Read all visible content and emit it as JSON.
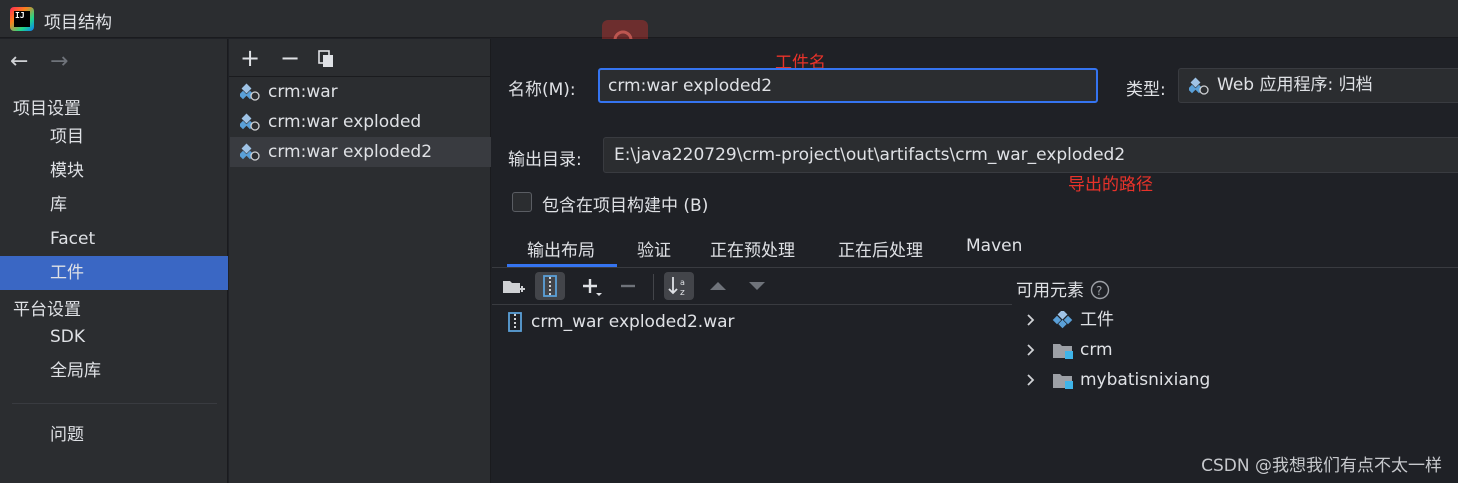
{
  "window": {
    "title": "项目结构"
  },
  "sidebar": {
    "project_settings_label": "项目设置",
    "project_items": [
      {
        "label": "项目"
      },
      {
        "label": "模块"
      },
      {
        "label": "库"
      },
      {
        "label": "Facet"
      },
      {
        "label": "工件",
        "selected": true
      }
    ],
    "platform_settings_label": "平台设置",
    "platform_items": [
      {
        "label": "SDK"
      },
      {
        "label": "全局库"
      }
    ],
    "problems_label": "问题"
  },
  "artifacts": {
    "items": [
      {
        "label": "crm:war"
      },
      {
        "label": "crm:war exploded"
      },
      {
        "label": "crm:war exploded2",
        "selected": true
      }
    ]
  },
  "form": {
    "name_label": "名称(M):",
    "name_value": "crm:war exploded2",
    "type_label": "类型:",
    "type_value": "Web 应用程序: 归档",
    "output_label": "输出目录:",
    "output_value": "E:\\java220729\\crm-project\\out\\artifacts\\crm_war_exploded2",
    "include_build_label": "包含在项目构建中 (B)",
    "include_build_checked": false
  },
  "annotations": {
    "name_note": "工件名",
    "path_note": "导出的路径"
  },
  "tabs": [
    {
      "label": "输出布局",
      "active": true
    },
    {
      "label": "验证"
    },
    {
      "label": "正在预处理"
    },
    {
      "label": "正在后处理"
    },
    {
      "label": "Maven"
    }
  ],
  "layout": {
    "root_item": "crm_war exploded2.war"
  },
  "available": {
    "title": "可用元素",
    "items": [
      {
        "label": "工件",
        "icon": "artifact-icon"
      },
      {
        "label": "crm",
        "icon": "module-folder-icon"
      },
      {
        "label": "mybatisnixiang",
        "icon": "module-folder-icon"
      }
    ]
  },
  "watermark": "CSDN @我想我们有点不太一样",
  "colors": {
    "accent": "#3574f0",
    "selection": "#3a67c4",
    "annotation": "#e8322a",
    "background": "#1f2126",
    "panel": "#2b2d30"
  }
}
